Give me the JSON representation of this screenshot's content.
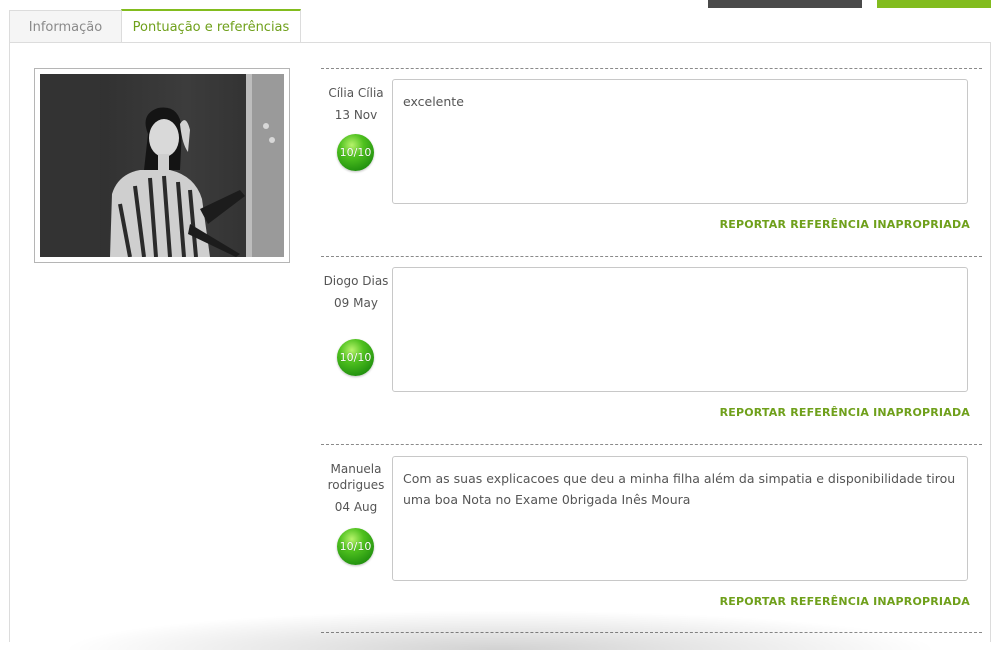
{
  "tabs": [
    {
      "label": "Informação",
      "active": false
    },
    {
      "label": "Pontuação e referências",
      "active": true
    }
  ],
  "colors": {
    "accent": "#82bc1e",
    "accent_text": "#6fa01b",
    "dark_button": "#4a4a4a"
  },
  "reviews": [
    {
      "author": "Cília Cília",
      "date": "13 Nov",
      "score": "10/10",
      "text": "excelente",
      "report_label": "REPORTAR REFERÊNCIA INAPROPRIADA"
    },
    {
      "author": "Diogo Dias",
      "date": "09 May",
      "score": "10/10",
      "text": "",
      "report_label": "REPORTAR REFERÊNCIA INAPROPRIADA"
    },
    {
      "author": "Manuela rodrigues",
      "date": "04 Aug",
      "score": "10/10",
      "text": "Com as suas explicacoes que deu a minha filha além da simpatia e disponibilidade tirou uma boa Nota no Exame 0brigada Inês Moura",
      "report_label": "REPORTAR REFERÊNCIA INAPROPRIADA"
    }
  ]
}
